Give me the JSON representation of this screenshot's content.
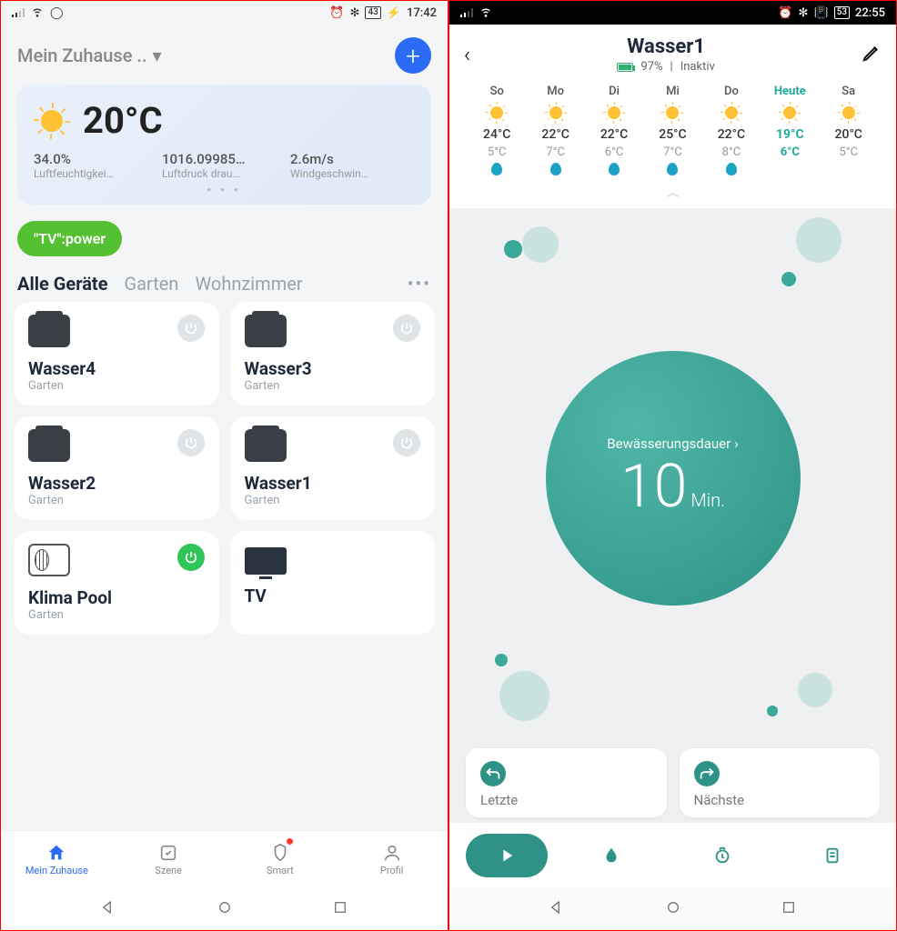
{
  "left": {
    "status": {
      "battery": "43",
      "time": "17:42"
    },
    "home": "Mein Zuhause ..",
    "weather": {
      "temp": "20°C",
      "stats": [
        {
          "val": "34.0%",
          "lbl": "Luftfeuchtigkei…"
        },
        {
          "val": "1016.09985…",
          "lbl": "Luftdruck drau…"
        },
        {
          "val": "2.6m/s",
          "lbl": "Windgeschwin…"
        }
      ]
    },
    "pill": "\"TV\":power",
    "tabs": [
      "Alle Geräte",
      "Garten",
      "Wohnzimmer"
    ],
    "devices": [
      {
        "name": "Wasser4",
        "room": "Garten",
        "kind": "valve",
        "on": false
      },
      {
        "name": "Wasser3",
        "room": "Garten",
        "kind": "valve",
        "on": false
      },
      {
        "name": "Wasser2",
        "room": "Garten",
        "kind": "valve",
        "on": false
      },
      {
        "name": "Wasser1",
        "room": "Garten",
        "kind": "valve",
        "on": false
      },
      {
        "name": "Klima Pool",
        "room": "Garten",
        "kind": "ac",
        "on": true
      },
      {
        "name": "TV",
        "room": "",
        "kind": "tv",
        "on": false,
        "noPower": true
      }
    ],
    "nav": [
      "Mein Zuhause",
      "Szene",
      "Smart",
      "Profil"
    ]
  },
  "right": {
    "status": {
      "battery": "53",
      "time": "22:55"
    },
    "title": "Wasser1",
    "battery_pct": "97%",
    "state": "Inaktiv",
    "forecast": [
      {
        "d": "So",
        "hi": "24°C",
        "lo": "5°C",
        "rain": true
      },
      {
        "d": "Mo",
        "hi": "22°C",
        "lo": "7°C",
        "rain": true
      },
      {
        "d": "Di",
        "hi": "22°C",
        "lo": "6°C",
        "rain": true
      },
      {
        "d": "Mi",
        "hi": "25°C",
        "lo": "7°C",
        "rain": true
      },
      {
        "d": "Do",
        "hi": "22°C",
        "lo": "8°C",
        "rain": true
      },
      {
        "d": "Heute",
        "hi": "19°C",
        "lo": "6°C",
        "rain": false,
        "today": true
      },
      {
        "d": "Sa",
        "hi": "20°C",
        "lo": "5°C",
        "rain": false
      }
    ],
    "dial": {
      "label": "Bewässerungsdauer",
      "value": "10",
      "unit": "Min."
    },
    "hist": {
      "last": "Letzte",
      "next": "Nächste"
    }
  }
}
